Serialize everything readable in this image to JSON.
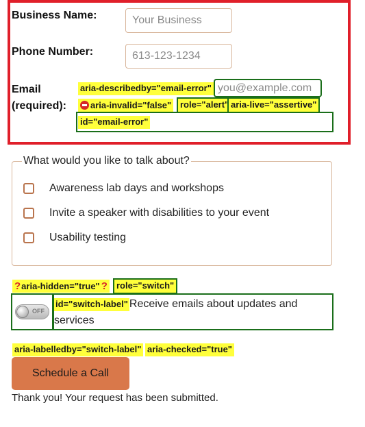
{
  "form": {
    "business_name_label": "Business Name:",
    "business_name_placeholder": "Your Business",
    "phone_label": "Phone Number:",
    "phone_placeholder": "613-123-1234",
    "email_label_line1": "Email",
    "email_label_line2": "(required):",
    "email_placeholder": "you@example.com"
  },
  "annotations": {
    "describedby": "aria-describedby=\"email-error\"",
    "invalid": "aria-invalid=\"false\"",
    "role_alert": "role=\"alert\"",
    "live": "aria-live=\"assertive\"",
    "error_id": "id=\"email-error\"",
    "hidden": "aria-hidden=\"true\"",
    "role_switch": "role=\"switch\"",
    "switch_label_id": "id=\"switch-label\"",
    "labelledby": "aria-labelledby=\"switch-label\"",
    "checked": "aria-checked=\"true\""
  },
  "topics": {
    "legend": "What would you like to talk about?",
    "options": [
      {
        "label": "Awareness lab days and workshops",
        "checked": false
      },
      {
        "label": "Invite a speaker with disabilities to your event",
        "checked": false
      },
      {
        "label": "Usability testing",
        "checked": false
      }
    ]
  },
  "switch": {
    "state_text": "OFF",
    "label": "Receive emails about updates and services"
  },
  "cta": {
    "button_label": "Schedule a Call",
    "confirmation": "Thank you! Your request has been submitted."
  },
  "colors": {
    "error_outline": "#e01f2a",
    "annotation_highlight": "#ffff3b",
    "annotation_outline": "#1a6e1a",
    "button_bg": "#d9784a",
    "checkbox_border": "#b9744d"
  }
}
